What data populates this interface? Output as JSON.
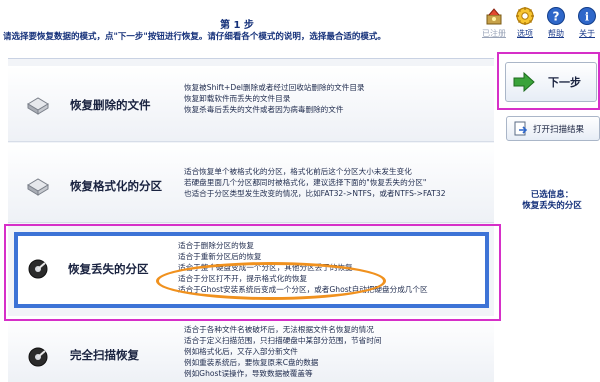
{
  "header": {
    "step_title": "第 1 步",
    "instruction": "请选择要恢复数据的模式，点\"下一步\"按钮进行恢复。请仔细看各个模式的说明，选择最合适的模式。",
    "tools": [
      {
        "icon": "register-icon",
        "label": "已注册",
        "enabled": false
      },
      {
        "icon": "options-gear-icon",
        "label": "选项",
        "enabled": true
      },
      {
        "icon": "help-icon",
        "label": "帮助",
        "enabled": true
      },
      {
        "icon": "about-icon",
        "label": "关于",
        "enabled": true
      }
    ]
  },
  "modes": [
    {
      "name": "恢复删除的文件",
      "desc": [
        "恢复被Shift+Del删除或者经过回收站删除的文件目录",
        "恢复卸载软件而丢失的文件目录",
        "恢复杀毒后丢失的文件或者因为病毒删除的文件"
      ]
    },
    {
      "name": "恢复格式化的分区",
      "desc": [
        "适合恢复单个被格式化的分区，格式化前后这个分区大小未发生变化",
        "若硬盘里面几个分区都同时被格式化，建议选择下面的\"恢复丢失的分区\"",
        "也适合于分区类型发生改变的情况，比如FAT32->NTFS，或者NTFS->FAT32"
      ]
    },
    {
      "name": "恢复丢失的分区",
      "desc": [
        "适合于删除分区的恢复",
        "适合于重新分区后的恢复",
        "适合于整个硬盘变成一个分区，其他分区丢了的恢复",
        "适合于分区打不开，提示格式化的恢复",
        "适合于Ghost安装系统后变成一个分区，或者Ghost自动把硬盘分成几个区"
      ]
    },
    {
      "name": "完全扫描恢复",
      "desc": [
        "适合于各种文件名被破坏后，无法根据文件名恢复的情况",
        "适合于定义扫描范围，只扫描硬盘中某部分范围，节省时间",
        "例如格式化后，又存入部分新文件",
        "例如重装系统后，要恢复原来C盘的数据",
        "例如Ghost误操作，导致数据被覆盖等"
      ]
    }
  ],
  "right_panel": {
    "next_label": "下一步",
    "open_scan_label": "打开扫描结果",
    "selected_info_title": "已选信息：",
    "selected_info_value": "恢复丢失的分区"
  },
  "colors": {
    "selection_border": "#3d73d6",
    "annotation_pink": "#d62fc8",
    "annotation_orange": "#f0911e",
    "heading_blue": "#14307a"
  }
}
